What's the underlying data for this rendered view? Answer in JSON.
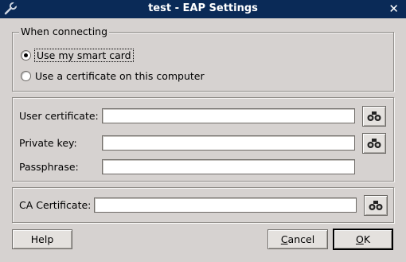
{
  "window": {
    "title": "test - EAP Settings",
    "close_glyph": "✕"
  },
  "connecting": {
    "legend": "When connecting",
    "options": [
      {
        "label": "Use my smart card",
        "checked": true
      },
      {
        "label": "Use a certificate on this computer",
        "checked": false
      }
    ]
  },
  "certs": {
    "user_certificate_label": "User certificate:",
    "user_certificate_value": "",
    "private_key_label": "Private key:",
    "private_key_value": "",
    "passphrase_label": "Passphrase:",
    "passphrase_value": ""
  },
  "ca": {
    "label": "CA Certificate:",
    "value": ""
  },
  "buttons": {
    "help": "Help",
    "cancel_first": "C",
    "cancel_rest": "ancel",
    "ok_first": "O",
    "ok_rest": "K"
  },
  "icons": {
    "window": "wrench-icon",
    "browse": "binoculars-icon",
    "close": "close-icon"
  }
}
